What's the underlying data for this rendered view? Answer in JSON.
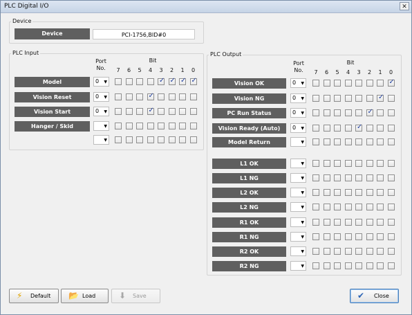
{
  "window": {
    "title": "PLC Digital I/O",
    "close_glyph": "✕"
  },
  "device": {
    "group_title": "Device",
    "label": "Device",
    "value": "PCI-1756,BID#0"
  },
  "plc_input": {
    "group_title": "PLC Input",
    "port_header": "Port\nNo.",
    "bit_header": "Bit",
    "bits": [
      "7",
      "6",
      "5",
      "4",
      "3",
      "2",
      "1",
      "0"
    ],
    "rows": [
      {
        "label": "Model",
        "port": "0",
        "checked": [
          false,
          false,
          false,
          false,
          true,
          true,
          true,
          true
        ]
      },
      {
        "label": "Vision Reset",
        "port": "0",
        "checked": [
          false,
          false,
          false,
          true,
          false,
          false,
          false,
          false
        ]
      },
      {
        "label": "Vision Start",
        "port": "0",
        "checked": [
          false,
          false,
          false,
          true,
          false,
          false,
          false,
          false
        ]
      },
      {
        "label": "Hanger / Skid",
        "port": "",
        "checked": [
          false,
          false,
          false,
          false,
          false,
          false,
          false,
          false
        ]
      },
      {
        "label": "",
        "port": "",
        "checked": [
          false,
          false,
          false,
          false,
          false,
          false,
          false,
          false
        ]
      }
    ]
  },
  "plc_output": {
    "group_title": "PLC Output",
    "port_header": "Port\nNo.",
    "bit_header": "Bit",
    "bits": [
      "7",
      "6",
      "5",
      "4",
      "3",
      "2",
      "1",
      "0"
    ],
    "rows": [
      {
        "label": "Vision OK",
        "port": "0",
        "checked": [
          false,
          false,
          false,
          false,
          false,
          false,
          false,
          true
        ]
      },
      {
        "label": "Vision NG",
        "port": "0",
        "checked": [
          false,
          false,
          false,
          false,
          false,
          false,
          true,
          false
        ]
      },
      {
        "label": "PC Run Status",
        "port": "0",
        "checked": [
          false,
          false,
          false,
          false,
          false,
          true,
          false,
          false
        ]
      },
      {
        "label": "Vision Ready (Auto)",
        "port": "0",
        "checked": [
          false,
          false,
          false,
          false,
          true,
          false,
          false,
          false
        ]
      },
      {
        "label": "Model Return",
        "port": "",
        "checked": [
          false,
          false,
          false,
          false,
          false,
          false,
          false,
          false
        ]
      },
      {
        "label": "L1 OK",
        "port": "",
        "checked": [
          false,
          false,
          false,
          false,
          false,
          false,
          false,
          false
        ]
      },
      {
        "label": "L1 NG",
        "port": "",
        "checked": [
          false,
          false,
          false,
          false,
          false,
          false,
          false,
          false
        ]
      },
      {
        "label": "L2 OK",
        "port": "",
        "checked": [
          false,
          false,
          false,
          false,
          false,
          false,
          false,
          false
        ]
      },
      {
        "label": "L2 NG",
        "port": "",
        "checked": [
          false,
          false,
          false,
          false,
          false,
          false,
          false,
          false
        ]
      },
      {
        "label": "R1 OK",
        "port": "",
        "checked": [
          false,
          false,
          false,
          false,
          false,
          false,
          false,
          false
        ]
      },
      {
        "label": "R1 NG",
        "port": "",
        "checked": [
          false,
          false,
          false,
          false,
          false,
          false,
          false,
          false
        ]
      },
      {
        "label": "R2 OK",
        "port": "",
        "checked": [
          false,
          false,
          false,
          false,
          false,
          false,
          false,
          false
        ]
      },
      {
        "label": "R2 NG",
        "port": "",
        "checked": [
          false,
          false,
          false,
          false,
          false,
          false,
          false,
          false
        ]
      }
    ]
  },
  "buttons": {
    "default": {
      "label": "Default",
      "icon": "lightning-icon"
    },
    "load": {
      "label": "Load",
      "icon": "folder-icon"
    },
    "save": {
      "label": "Save",
      "icon": "save-icon"
    },
    "close": {
      "label": "Close",
      "icon": "checkmark-icon"
    }
  },
  "colors": {
    "label_bg": "#5f5f5f",
    "check": "#22409d"
  }
}
